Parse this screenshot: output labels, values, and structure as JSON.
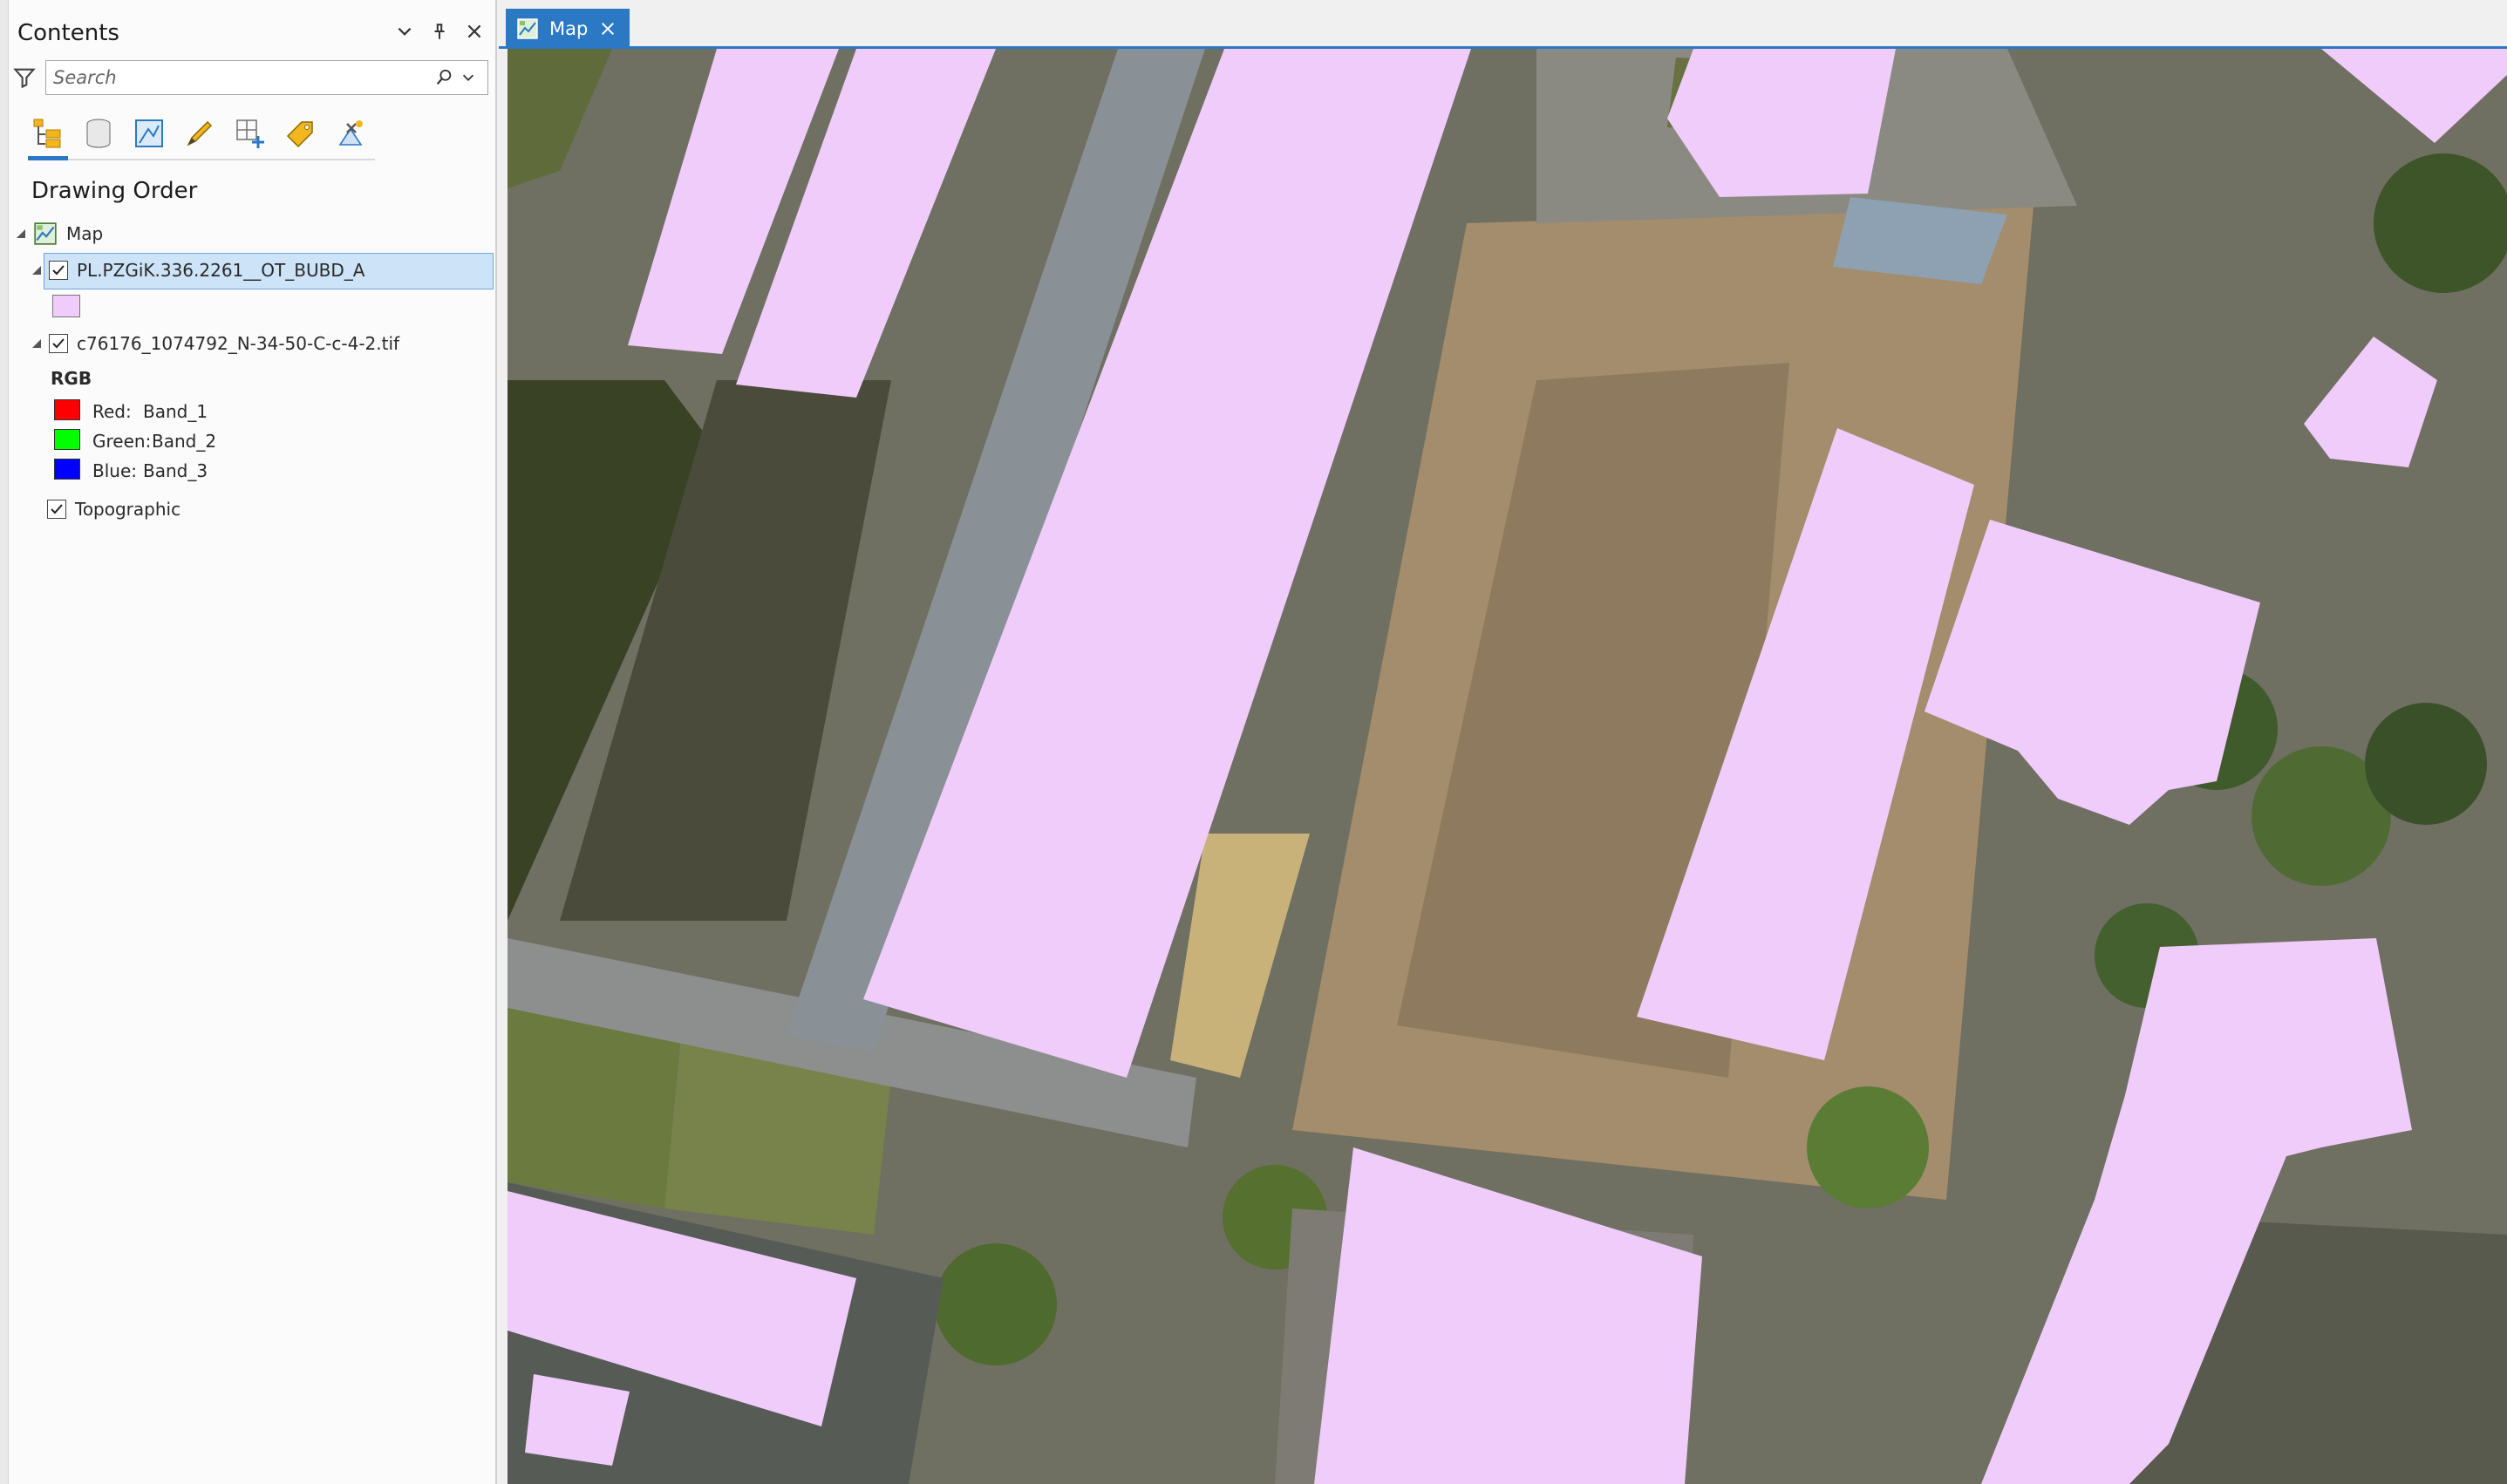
{
  "contents": {
    "title": "Contents",
    "search_placeholder": "Search",
    "drawing_order_label": "Drawing Order",
    "map_label": "Map",
    "layers": [
      {
        "name": "PL.PZGiK.336.2261__OT_BUBD_A",
        "checked": true,
        "symbol_color": "#f0ccfb"
      },
      {
        "name": "c76176_1074792_N-34-50-C-c-4-2.tif",
        "checked": true
      }
    ],
    "raster_legend": {
      "title": "RGB",
      "bands": [
        {
          "label": "Red:",
          "band": "Band_1",
          "color": "#ff0000"
        },
        {
          "label": "Green:",
          "band": "Band_2",
          "color": "#00ff00"
        },
        {
          "label": "Blue:",
          "band": "Band_3",
          "color": "#0000ff"
        }
      ]
    },
    "basemap": {
      "name": "Topographic",
      "checked": true
    }
  },
  "map_tab": {
    "label": "Map"
  },
  "colors": {
    "accent": "#2b78c5",
    "building_fill": "#f0ccfb",
    "selection": "#cde3f7"
  }
}
